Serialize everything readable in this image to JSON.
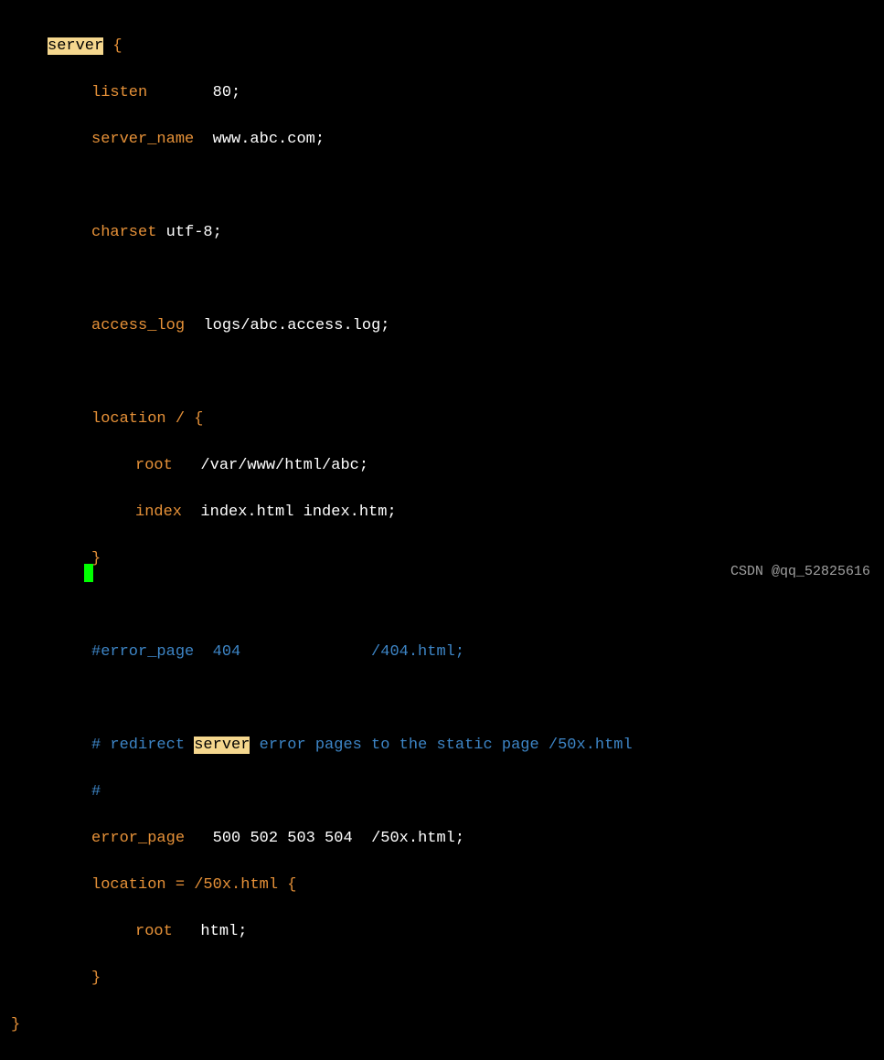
{
  "server_kw": "server",
  "brace_open": " {",
  "listen_kw": "listen",
  "listen_pad": "       ",
  "listen_val": "80;",
  "server_name_kw": "server_name",
  "server_name_pad": "  ",
  "server_name_val": "www.abc.com;",
  "charset_kw": "charset",
  "charset_val": " utf-8;",
  "access_log_kw": "access_log",
  "access_log_pad": "  ",
  "access_log_val": "logs/abc.access.log;",
  "location_kw": "location",
  "location_path": " / {",
  "root_kw": "root",
  "root_pad": "   ",
  "root_val": "/var/www/html/abc;",
  "index_kw": "index",
  "index_pad": "  ",
  "index_val": "index.html index.htm;",
  "brace_close": "}",
  "error_comment": "#error_page  404              /404.html;",
  "redirect_c1": "# redirect ",
  "redirect_hl": "server",
  "redirect_c2": " error pages to the static page /50x.html",
  "hash_only": "#",
  "error_page_kw": "error_page",
  "error_page_pad": "   ",
  "error_page_val": "500 502 503 504  /50x.html;",
  "loc2_kw": "location",
  "loc2_val": " = /50x.html {",
  "root2_kw": "root",
  "root2_pad": "   ",
  "root2_val": "html;",
  "watermark": "CSDN @qq_52825616"
}
